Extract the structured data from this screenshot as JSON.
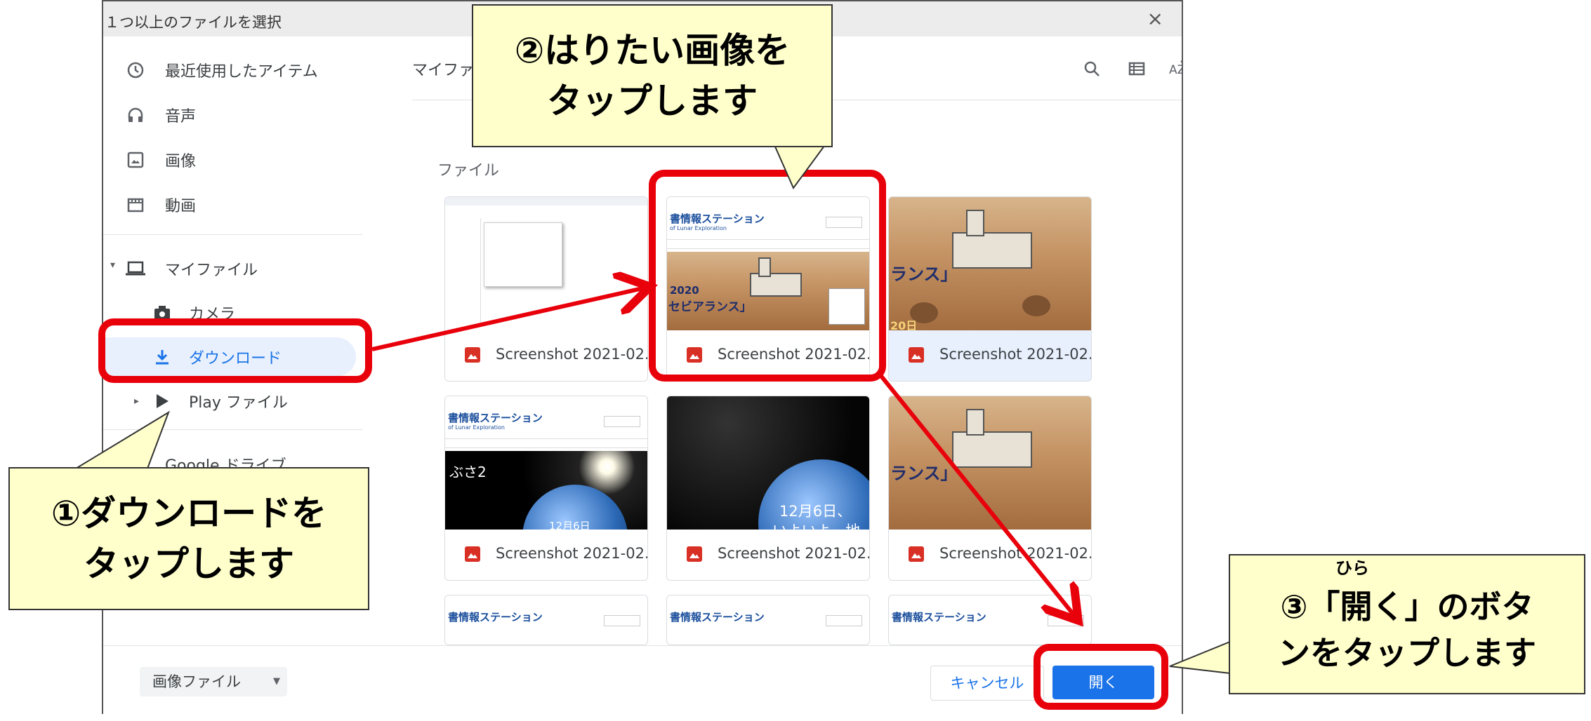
{
  "dialog": {
    "title": "１つ以上のファイルを選択",
    "close": "×"
  },
  "sidebar": {
    "items": [
      {
        "label": "最近使用したアイテム",
        "icon": "clock-icon"
      },
      {
        "label": "音声",
        "icon": "headphones-icon"
      },
      {
        "label": "画像",
        "icon": "image-icon"
      },
      {
        "label": "動画",
        "icon": "film-icon"
      },
      {
        "label": "マイファイル",
        "icon": "laptop-icon"
      },
      {
        "label": "カメラ",
        "icon": "camera-icon"
      },
      {
        "label": "ダウンロード",
        "icon": "download-icon"
      },
      {
        "label": "Play ファイル",
        "icon": "play-icon"
      },
      {
        "label": "Google ドライブ",
        "icon": "drive-icon"
      }
    ]
  },
  "topbar": {
    "breadcrumb": "マイファ"
  },
  "section": {
    "title": "ファイル"
  },
  "files": [
    {
      "name": "Screenshot 2021-02..."
    },
    {
      "name": "Screenshot 2021-02..."
    },
    {
      "name": "Screenshot 2021-02..."
    },
    {
      "name": "Screenshot 2021-02..."
    },
    {
      "name": "Screenshot 2021-02..."
    },
    {
      "name": "Screenshot 2021-02..."
    }
  ],
  "thumbs": {
    "station": "書情報ステーション",
    "station_sub": "of Lunar Exploration",
    "year": "2020",
    "perseverance": "セビアランス」",
    "ransu": "ランス」",
    "day": "20日",
    "busa": "ぶさ2",
    "dec6": "12月6日、",
    "dec6b": "12月6日",
    "iyoiyo": "いよいよ　地"
  },
  "footer": {
    "filetype": "画像ファイル",
    "cancel": "キャンセル",
    "open": "開く"
  },
  "callouts": {
    "step1_line1": "①ダウンロードを",
    "step1_line2": "タップします",
    "step2_line1": "②はりたい画像を",
    "step2_line2": "タップします",
    "step3_ruby": "ひら",
    "step3_line1": "③「開く」のボタ",
    "step3_line2": "ンをタップします"
  },
  "colors": {
    "accent": "#1a73e8",
    "highlight": "#e8000b",
    "callout_bg": "#ffffcc"
  }
}
